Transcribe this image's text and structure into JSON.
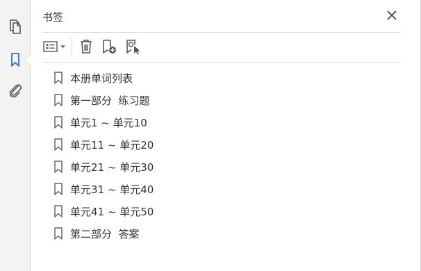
{
  "panel": {
    "title": "书签"
  },
  "bookmarks": [
    {
      "label": "本册单词列表"
    },
    {
      "label": "第一部分  练习题"
    },
    {
      "label": "单元1 ~ 单元10"
    },
    {
      "label": "单元11 ~ 单元20"
    },
    {
      "label": "单元21 ~ 单元30"
    },
    {
      "label": "单元31 ~ 单元40"
    },
    {
      "label": "单元41 ~ 单元50"
    },
    {
      "label": "第二部分  答案"
    }
  ],
  "icons": {
    "rail": [
      "pages-icon",
      "bookmark-icon",
      "attachment-icon"
    ],
    "toolbar": [
      "options-menu-icon",
      "delete-icon",
      "new-bookmark-icon",
      "find-bookmark-icon"
    ],
    "close": "close-icon",
    "item": "bookmark-outline-icon"
  },
  "colors": {
    "accent": "#2b72c6",
    "icon": "#555555",
    "text": "#333333"
  }
}
